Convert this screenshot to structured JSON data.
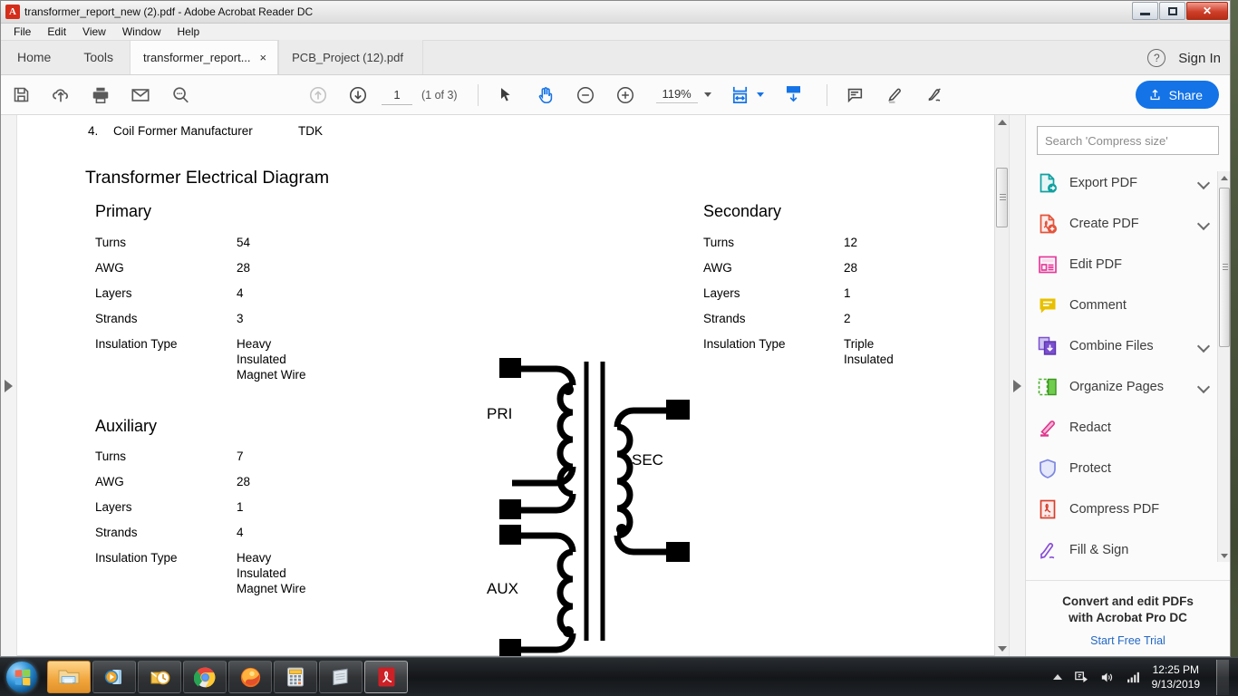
{
  "window": {
    "title": "transformer_report_new (2).pdf - Adobe Acrobat Reader DC",
    "app_icon": "acrobat-icon",
    "minimize_label": "Minimize",
    "restore_label": "Restore",
    "close_label": "Close"
  },
  "menu": {
    "items": [
      {
        "label": "File"
      },
      {
        "label": "Edit"
      },
      {
        "label": "View"
      },
      {
        "label": "Window"
      },
      {
        "label": "Help"
      }
    ]
  },
  "tabstrip": {
    "nav": [
      {
        "label": "Home"
      },
      {
        "label": "Tools"
      }
    ],
    "documents": [
      {
        "label": "transformer_report...",
        "active": true,
        "close": "×"
      },
      {
        "label": "PCB_Project (12).pdf",
        "active": false
      }
    ],
    "help_glyph": "?",
    "signin_label": "Sign In"
  },
  "toolbar": {
    "left_icons": [
      {
        "name": "save-icon",
        "title": "Save File"
      },
      {
        "name": "upload-cloud-icon",
        "title": "Save to cloud"
      },
      {
        "name": "print-icon",
        "title": "Print File"
      },
      {
        "name": "email-icon",
        "title": "Email File"
      },
      {
        "name": "search-icon",
        "title": "Find"
      }
    ],
    "page_prev_title": "Previous Page",
    "page_next_title": "Next Page",
    "page_value": "1",
    "page_of": "(1 of 3)",
    "select_title": "Select Tool",
    "hand_title": "Hand Tool",
    "zoom_out_title": "Zoom Out",
    "zoom_in_title": "Zoom In",
    "zoom_value": "119%",
    "fit_title": "Fit Width",
    "scroll_title": "Scrolling Mode",
    "comment_title": "Add Comment",
    "highlight_title": "Highlight Text",
    "sign_title": "Fill & Sign",
    "share_label": "Share",
    "accent_blue": "#1473e6"
  },
  "document": {
    "list_item": {
      "number": "4.",
      "label": "Coil Former Manufacturer",
      "value": "TDK"
    },
    "heading": "Transformer Electrical Diagram",
    "field_labels": [
      "Turns",
      "AWG",
      "Layers",
      "Strands",
      "Insulation Type"
    ],
    "sections": [
      {
        "name": "Primary",
        "values": [
          "54",
          "28",
          "4",
          "3"
        ],
        "insulation": [
          "Heavy",
          "Insulated",
          "Magnet Wire"
        ]
      },
      {
        "name": "Auxiliary",
        "values": [
          "7",
          "28",
          "1",
          "4"
        ],
        "insulation": [
          "Heavy",
          "Insulated",
          "Magnet Wire"
        ]
      },
      {
        "name": "Secondary",
        "values": [
          "12",
          "28",
          "1",
          "2"
        ],
        "insulation": [
          "Triple",
          "Insulated"
        ]
      }
    ],
    "diagram": {
      "primary_label": "PRI",
      "secondary_label": "SEC",
      "auxiliary_label": "AUX"
    }
  },
  "tools_panel": {
    "search_placeholder": "Search 'Compress size'",
    "items": [
      {
        "label": "Export PDF",
        "icon": "export-pdf-icon",
        "color": "#11a0a0",
        "chevron": true
      },
      {
        "label": "Create PDF",
        "icon": "create-pdf-icon",
        "color": "#e2543b",
        "chevron": true
      },
      {
        "label": "Edit PDF",
        "icon": "edit-pdf-icon",
        "color": "#e6399b",
        "chevron": false
      },
      {
        "label": "Comment",
        "icon": "comment-icon",
        "color": "#e8c000",
        "chevron": false
      },
      {
        "label": "Combine Files",
        "icon": "combine-files-icon",
        "color": "#7a4fd0",
        "chevron": true
      },
      {
        "label": "Organize Pages",
        "icon": "organize-pages-icon",
        "color": "#49b02a",
        "chevron": true
      },
      {
        "label": "Redact",
        "icon": "redact-icon",
        "color": "#e0358c",
        "chevron": false
      },
      {
        "label": "Protect",
        "icon": "protect-icon",
        "color": "#7b86e0",
        "chevron": false
      },
      {
        "label": "Compress PDF",
        "icon": "compress-pdf-icon",
        "color": "#d4402c",
        "chevron": false
      },
      {
        "label": "Fill & Sign",
        "icon": "fill-sign-icon",
        "color": "#8a4fd6",
        "chevron": false
      }
    ],
    "promo_line1": "Convert and edit PDFs",
    "promo_line2": "with Acrobat Pro DC",
    "promo_link": "Start Free Trial"
  },
  "taskbar": {
    "start_title": "Start",
    "items": [
      {
        "name": "file-explorer-icon",
        "title": "File Explorer",
        "state": "hot"
      },
      {
        "name": "media-player-icon",
        "title": "Windows Media Player",
        "state": "normal"
      },
      {
        "name": "outlook-icon",
        "title": "Microsoft Outlook",
        "state": "normal"
      },
      {
        "name": "chrome-icon",
        "title": "Google Chrome",
        "state": "normal"
      },
      {
        "name": "firefox-icon",
        "title": "Mozilla Firefox",
        "state": "normal"
      },
      {
        "name": "calculator-icon",
        "title": "Calculator",
        "state": "normal"
      },
      {
        "name": "notepad-icon",
        "title": "Notepad",
        "state": "normal"
      },
      {
        "name": "acrobat-reader-icon",
        "title": "Adobe Acrobat Reader DC",
        "state": "active-red"
      }
    ],
    "tray": {
      "show_hidden_title": "Show hidden icons",
      "action_center_title": "Action Center",
      "volume_title": "Volume",
      "network_title": "Network"
    },
    "clock_time": "12:25 PM",
    "clock_date": "9/13/2019"
  }
}
